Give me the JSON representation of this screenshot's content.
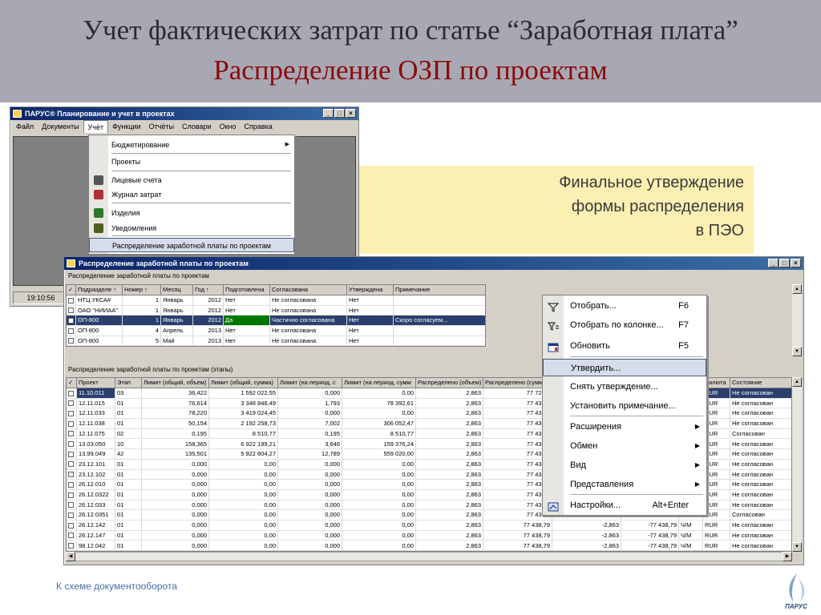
{
  "header": {
    "title": "Учет фактических затрат по статье “Заработная плата”",
    "subtitle": "Распределение ОЗП по проектам"
  },
  "callout": {
    "line1": "Финальное утверждение",
    "line2": "формы распределения",
    "line3": "в ПЭО"
  },
  "main_window": {
    "title": "ПАРУС® Планирование и учет в проектах",
    "menu": [
      "Файл",
      "Документы",
      "Учёт",
      "Функции",
      "Отчёты",
      "Словари",
      "Окно",
      "Справка"
    ],
    "active_menu": "Учёт",
    "status_time": "19:10:56",
    "dropdown": [
      {
        "label": "Бюджетирование",
        "submenu": true
      },
      {
        "label": "Проекты"
      },
      {
        "label": "Лицевые счета",
        "icon": "person-icon"
      },
      {
        "label": "Журнал затрат",
        "icon": "journal-icon"
      },
      {
        "label": "Изделия",
        "icon": "cube-icon"
      },
      {
        "label": "Уведомления",
        "icon": "notify-icon"
      },
      {
        "label": "Распределение заработной платы по проектам",
        "selected": true
      }
    ]
  },
  "doc_window": {
    "title": "Распределение заработной платы по проектам",
    "top_caption": "Распределение заработной платы по проектам",
    "top_headers": [
      "✓",
      "Подразделе ↑",
      "Номер ↑",
      "Месяц",
      "Год ↑",
      "Подготовлена",
      "Согласована",
      "Утверждена",
      "Примечание"
    ],
    "top_rows": [
      [
        "НТЦ УКСА#",
        "1",
        "Январь",
        "2012",
        "Нет",
        "Не согласована",
        "Нет",
        ""
      ],
      [
        "ОАО \"НИИАА\"",
        "1",
        "Январь",
        "2012",
        "Нет",
        "Не согласована",
        "Нет",
        ""
      ],
      [
        "ОП-800",
        "1",
        "Январь",
        "2012",
        "Да",
        "Частично согласована",
        "Нет",
        "Скоро согласуем..."
      ],
      [
        "ОП-800",
        "4",
        "Апрель",
        "2013",
        "Нет",
        "Не согласована",
        "Нет",
        ""
      ],
      [
        "ОП-800",
        "5",
        "Май",
        "2013",
        "Нет",
        "Не согласована",
        "Нет",
        ""
      ]
    ],
    "bottom_caption": "Распределение заработной платы по проектам (этапы)",
    "bottom_headers": [
      "✓",
      "Проект",
      "Этап",
      "Лимит (общий, объем)",
      "Лимит (общий, сумма)",
      "Лимит (на период, с",
      "Лимит (на период, сумм",
      "Распределено (объем)",
      "Распределено (сумм",
      "",
      "",
      "",
      "Валюта",
      "Состояние"
    ],
    "bottom_rows": [
      [
        "11.10.011",
        "03",
        "36,422",
        "1 592 022,55",
        "0,000",
        "0,00",
        "2,863",
        "77 720,6",
        "",
        "",
        "",
        "RUR",
        "Не согласован"
      ],
      [
        "12.11.015",
        "01",
        "76,614",
        "3 348 848,49",
        "1,793",
        "78 392,61",
        "2,863",
        "77 438,7",
        "",
        "",
        "",
        "RUR",
        "Не согласован"
      ],
      [
        "12.11.033",
        "01",
        "78,220",
        "3 419 024,45",
        "0,000",
        "0,00",
        "2,863",
        "77 438,7",
        "",
        "",
        "",
        "RUR",
        "Не согласован"
      ],
      [
        "12.11.038",
        "01",
        "50,154",
        "2 192 258,73",
        "7,002",
        "306 052,47",
        "2,863",
        "77 438,7",
        "",
        "",
        "",
        "RUR",
        "Не согласован"
      ],
      [
        "12.11.075",
        "02",
        "0,195",
        "8 510,77",
        "0,195",
        "8 510,77",
        "2,863",
        "77 438,7",
        "",
        "",
        "",
        "RUR",
        "Согласован"
      ],
      [
        "13.03.050",
        "10",
        "158,365",
        "6 922 199,21",
        "3,646",
        "159 376,24",
        "2,863",
        "77 438,7",
        "",
        "",
        "",
        "RUR",
        "Не согласован"
      ],
      [
        "13.99.049",
        "42",
        "135,501",
        "5 922 804,27",
        "12,789",
        "559 020,00",
        "2,863",
        "77 438,7",
        "",
        "",
        "",
        "RUR",
        "Не согласован"
      ],
      [
        "23.12.101",
        "01",
        "0,000",
        "0,00",
        "0,000",
        "0,00",
        "2,863",
        "77 438,7",
        "",
        "",
        "",
        "RUR",
        "Не согласован"
      ],
      [
        "23.12.102",
        "01",
        "0,000",
        "0,00",
        "0,000",
        "0,00",
        "2,863",
        "77 438,7",
        "",
        "",
        "",
        "RUR",
        "Не согласован"
      ],
      [
        "26.12.010",
        "01",
        "0,000",
        "0,00",
        "0,000",
        "0,00",
        "2,863",
        "77 438,7",
        "",
        "",
        "",
        "RUR",
        "Не согласован"
      ],
      [
        "26.12.0322",
        "01",
        "0,000",
        "0,00",
        "0,000",
        "0,00",
        "2,863",
        "77 438,7",
        "",
        "",
        "",
        "RUR",
        "Не согласован"
      ],
      [
        "26.12.033",
        "01",
        "0,000",
        "0,00",
        "0,000",
        "0,00",
        "2,863",
        "77 438,7",
        "",
        "",
        "",
        "RUR",
        "Не согласован"
      ],
      [
        "26.12.0351",
        "01",
        "0,000",
        "0,00",
        "0,000",
        "0,00",
        "2,863",
        "77 438,7",
        "",
        "",
        "",
        "RUR",
        "Согласован"
      ],
      [
        "26.12.142",
        "01",
        "0,000",
        "0,00",
        "0,000",
        "0,00",
        "2,863",
        "77 438,79",
        "-2,863",
        "-77 438,79",
        "Ч/М",
        "RUR",
        "Не согласован"
      ],
      [
        "26.12.147",
        "01",
        "0,000",
        "0,00",
        "0,000",
        "0,00",
        "2,863",
        "77 438,79",
        "-2,863",
        "-77 438,79",
        "Ч/М",
        "RUR",
        "Не согласован"
      ],
      [
        "98.12.042",
        "01",
        "0,000",
        "0,00",
        "0,000",
        "0,00",
        "2,863",
        "77 438,79",
        "-2,863",
        "-77 438,79",
        "Ч/М",
        "RUR",
        "Не согласован"
      ]
    ]
  },
  "context_menu": [
    {
      "label": "Отобрать...",
      "key": "F6",
      "icon": "filter-icon"
    },
    {
      "label": "Отобрать по колонке...",
      "key": "F7",
      "icon": "filter-column-icon"
    },
    {
      "label": "Обновить",
      "key": "F5",
      "icon": "refresh-icon"
    },
    {
      "label": "Утвердить...",
      "key": "",
      "selected": true
    },
    {
      "label": "Снять утверждение...",
      "key": ""
    },
    {
      "label": "Установить примечание...",
      "key": ""
    },
    {
      "label": "Расширения",
      "submenu": true
    },
    {
      "label": "Обмен",
      "submenu": true
    },
    {
      "label": "Вид",
      "submenu": true
    },
    {
      "label": "Представления",
      "submenu": true
    },
    {
      "label": "Настройки...",
      "key": "Alt+Enter",
      "icon": "settings-icon"
    }
  ],
  "footer": {
    "link": "К схеме документооборота"
  },
  "logo": {
    "text": "ПАРУС"
  },
  "colors": {
    "header_bg": "#a8a8b4",
    "subtitle": "#8b0a0a",
    "callout_bg": "#fbefb2",
    "selection": "#2a3f6e",
    "approved_green": "#007800"
  }
}
